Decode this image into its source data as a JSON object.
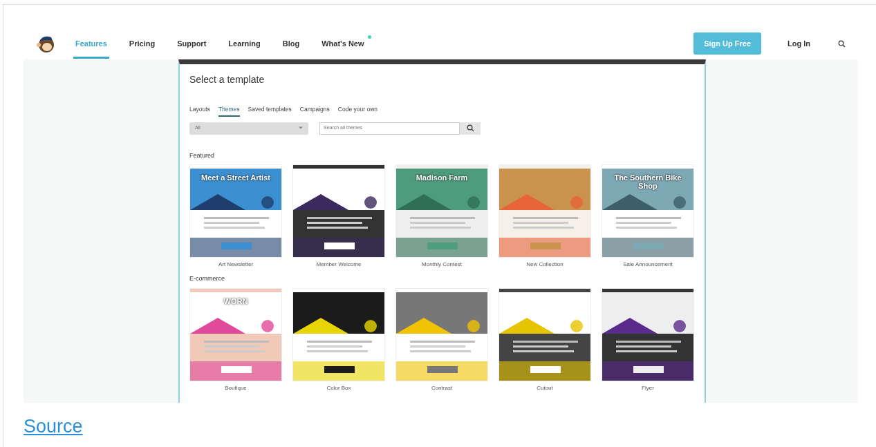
{
  "nav": {
    "items": [
      {
        "label": "Features",
        "selected": true,
        "new_dot": false
      },
      {
        "label": "Pricing",
        "selected": false,
        "new_dot": false
      },
      {
        "label": "Support",
        "selected": false,
        "new_dot": false
      },
      {
        "label": "Learning",
        "selected": false,
        "new_dot": false
      },
      {
        "label": "Blog",
        "selected": false,
        "new_dot": false
      },
      {
        "label": "What's New",
        "selected": false,
        "new_dot": true
      }
    ],
    "signup": "Sign Up Free",
    "login": "Log In"
  },
  "panel": {
    "title": "Select a template",
    "tabs": [
      {
        "label": "Layouts",
        "selected": false
      },
      {
        "label": "Themes",
        "selected": true
      },
      {
        "label": "Saved templates",
        "selected": false
      },
      {
        "label": "Campaigns",
        "selected": false
      },
      {
        "label": "Code your own",
        "selected": false
      }
    ],
    "filter": {
      "value": "All"
    },
    "search": {
      "placeholder": "Search all themes"
    },
    "sections": [
      {
        "title": "Featured",
        "templates": [
          {
            "name": "Art Newsletter",
            "headline": "Meet a Street Artist"
          },
          {
            "name": "Member Welcome"
          },
          {
            "name": "Monthly Contest",
            "headline": "Madison Farm"
          },
          {
            "name": "New Collection"
          },
          {
            "name": "Sale Announcement",
            "headline": "The Southern Bike Shop"
          }
        ]
      },
      {
        "title": "E-commerce",
        "templates": [
          {
            "name": "Boutique",
            "headline": "WORN"
          },
          {
            "name": "Color Box"
          },
          {
            "name": "Contrast"
          },
          {
            "name": "Cutout"
          },
          {
            "name": "Flyer"
          }
        ]
      }
    ]
  },
  "source_link": "Source"
}
